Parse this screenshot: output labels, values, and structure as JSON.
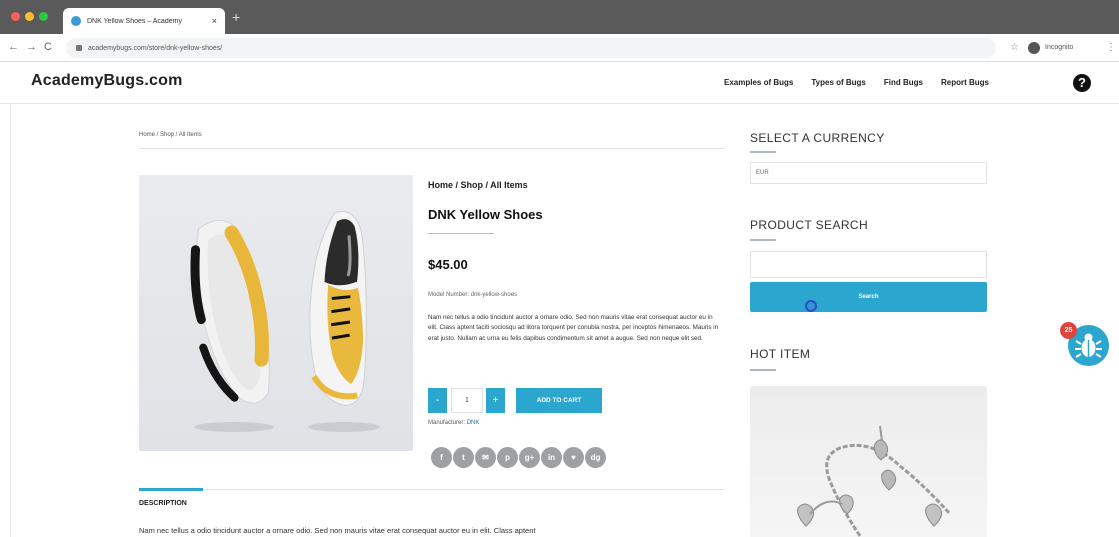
{
  "browser": {
    "tab_title": "DNK Yellow Shoes – Academy",
    "tab_close": "×",
    "new_tab": "+",
    "back": "←",
    "forward": "→",
    "reload": "C",
    "url": "academybugs.com/store/dnk-yellow-shoes/",
    "star": "☆",
    "incognito_label": "Incognito",
    "menu": "⋮"
  },
  "header": {
    "logo": "AcademyBugs.com",
    "nav": [
      "Examples of Bugs",
      "Types of Bugs",
      "Find Bugs",
      "Report Bugs"
    ],
    "help": "?"
  },
  "main": {
    "breadcrumb_top": "Home / Shop / All Items",
    "breadcrumb": "Home / Shop / All Items",
    "product_title": "DNK Yellow Shoes",
    "price": "$45.00",
    "model_number": "Model Number: dnk-yellow-shoes",
    "description_short": "Nam nec tellus a odio tincidunt auctor a ornare odio. Sed non mauris vitae erat consequat auctor eu in elit. Class aptent taciti sociosqu ad litora torquent per conubia nostra, per inceptos himenaeos. Mauris in erat justo. Nullam ac urna eu felis dapibus condimentum sit amet a augue. Sed non neque elit sed.",
    "qty_minus": "-",
    "qty_value": "1",
    "qty_plus": "+",
    "add_to_cart": "ADD TO CART",
    "manufacturer_label": "Manufacturer: ",
    "manufacturer_value": "DNK",
    "social": [
      "f",
      "t",
      "✉",
      "p",
      "g+",
      "in",
      "♥",
      "dg"
    ],
    "desc_tab": "DESCRIPTION",
    "desc_body": "Nam nec tellus a odio tincidunt auctor a ornare odio. Sed non mauris vitae erat consequat auctor eu in elit. Class aptent"
  },
  "sidebar": {
    "currency_heading": "SELECT A CURRENCY",
    "currency_value": "EUR",
    "search_heading": "PRODUCT SEARCH",
    "search_button": "Search",
    "hot_heading": "HOT ITEM"
  },
  "widget": {
    "badge_count": "25"
  },
  "colors": {
    "accent": "#2aa6cf",
    "badge": "#e0453b",
    "social_gray": "#9ea0a3"
  }
}
